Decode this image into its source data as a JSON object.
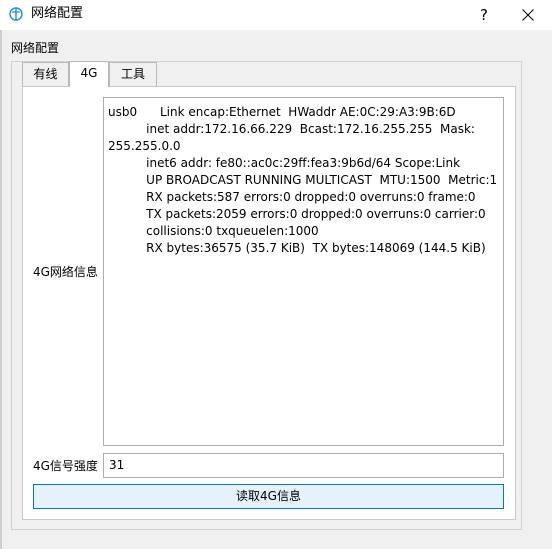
{
  "window": {
    "title": "网络配置",
    "help": "?"
  },
  "group": {
    "label": "网络配置"
  },
  "tabs": [
    {
      "label": "有线",
      "active": false
    },
    {
      "label": "4G",
      "active": true
    },
    {
      "label": "工具",
      "active": false
    }
  ],
  "fourg": {
    "info_label": "4G网络信息",
    "info_text": "usb0      Link encap:Ethernet  HWaddr AE:0C:29:A3:9B:6D\n          inet addr:172.16.66.229  Bcast:172.16.255.255  Mask:\n255.255.0.0\n          inet6 addr: fe80::ac0c:29ff:fea3:9b6d/64 Scope:Link\n          UP BROADCAST RUNNING MULTICAST  MTU:1500  Metric:1\n          RX packets:587 errors:0 dropped:0 overruns:0 frame:0\n          TX packets:2059 errors:0 dropped:0 overruns:0 carrier:0\n          collisions:0 txqueuelen:1000\n          RX bytes:36575 (35.7 KiB)  TX bytes:148069 (144.5 KiB)",
    "signal_label": "4G信号强度",
    "signal_value": "31",
    "read_button": "读取4G信息"
  },
  "colors": {
    "accent": "#0078d7",
    "button_bg": "#e5f1fb",
    "app_icon": "#1e88e5"
  },
  "icons": {
    "app": "network-app-icon",
    "close": "close-icon"
  }
}
